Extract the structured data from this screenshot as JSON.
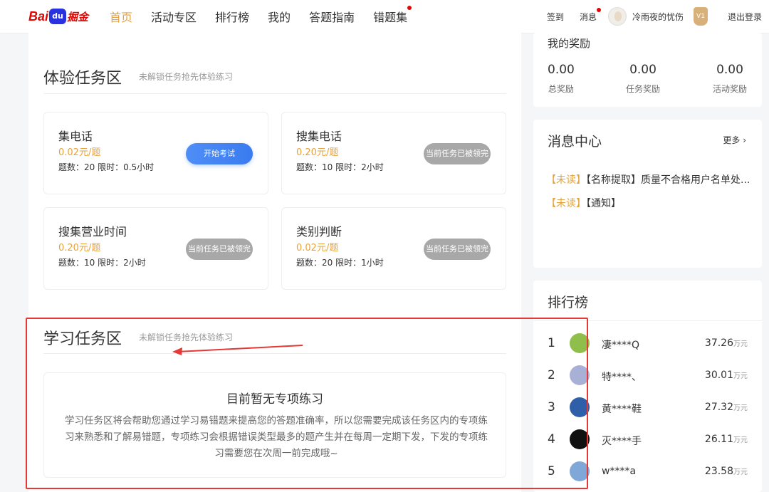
{
  "nav": {
    "logo_bai": "Bai",
    "logo_du": "du",
    "logo_jue": "掘金",
    "items": [
      "首页",
      "活动专区",
      "排行榜",
      "我的",
      "答题指南",
      "错题集"
    ]
  },
  "user": {
    "checkin": "签到",
    "messages": "消息",
    "username": "冷雨夜的忧伤",
    "vip": "V1",
    "logout": "退出登录"
  },
  "experience": {
    "title": "体验任务区",
    "subtitle": "未解锁任务抢先体验练习",
    "tasks": [
      {
        "name": "集电话",
        "price": "0.02元/题",
        "meta": "题数：20 限时：0.5小时",
        "button": "开始考试"
      },
      {
        "name": "搜集电话",
        "price": "0.20元/题",
        "meta": "题数：10 限时：2小时",
        "button": "当前任务已被领完"
      },
      {
        "name": "搜集营业时间",
        "price": "0.20元/题",
        "meta": "题数：10 限时：2小时",
        "button": "当前任务已被领完"
      },
      {
        "name": "类别判断",
        "price": "0.02元/题",
        "meta": "题数：20 限时：1小时",
        "button": "当前任务已被领完"
      }
    ]
  },
  "study": {
    "title": "学习任务区",
    "subtitle": "未解锁任务抢先体验练习",
    "empty_title": "目前暂无专项练习",
    "empty_desc": "学习任务区将会帮助您通过学习易错题来提高您的答题准确率，所以您需要完成该任务区内的专项练习来熟悉和了解易错题，专项练习会根据错误类型最多的题产生并在每周一定期下发，下发的专项练习需要您在次周一前完成哦~"
  },
  "rewards": {
    "title": "我的奖励",
    "items": [
      {
        "value": "0.00",
        "label": "总奖励"
      },
      {
        "value": "0.00",
        "label": "任务奖励"
      },
      {
        "value": "0.00",
        "label": "活动奖励"
      }
    ]
  },
  "messages_panel": {
    "title": "消息中心",
    "more": "更多",
    "items": [
      {
        "tag": "【未读】",
        "text": "【名称提取】质量不合格用户名单处..."
      },
      {
        "tag": "【未读】",
        "text": "【通知】"
      }
    ]
  },
  "ranking": {
    "title": "排行榜",
    "unit": "万元",
    "rows": [
      {
        "rank": "1",
        "name": "凄****Q",
        "score": "37.26",
        "avatar_color": "#8fbf4a"
      },
      {
        "rank": "2",
        "name": "特****、",
        "score": "30.01",
        "avatar_color": "#a9b0d6"
      },
      {
        "rank": "3",
        "name": "黄****鞋",
        "score": "27.32",
        "avatar_color": "#2f5fa8"
      },
      {
        "rank": "4",
        "name": "灭****手",
        "score": "26.11",
        "avatar_color": "#111111"
      },
      {
        "rank": "5",
        "name": "w****a",
        "score": "23.58",
        "avatar_color": "#7fa7d8"
      }
    ]
  }
}
